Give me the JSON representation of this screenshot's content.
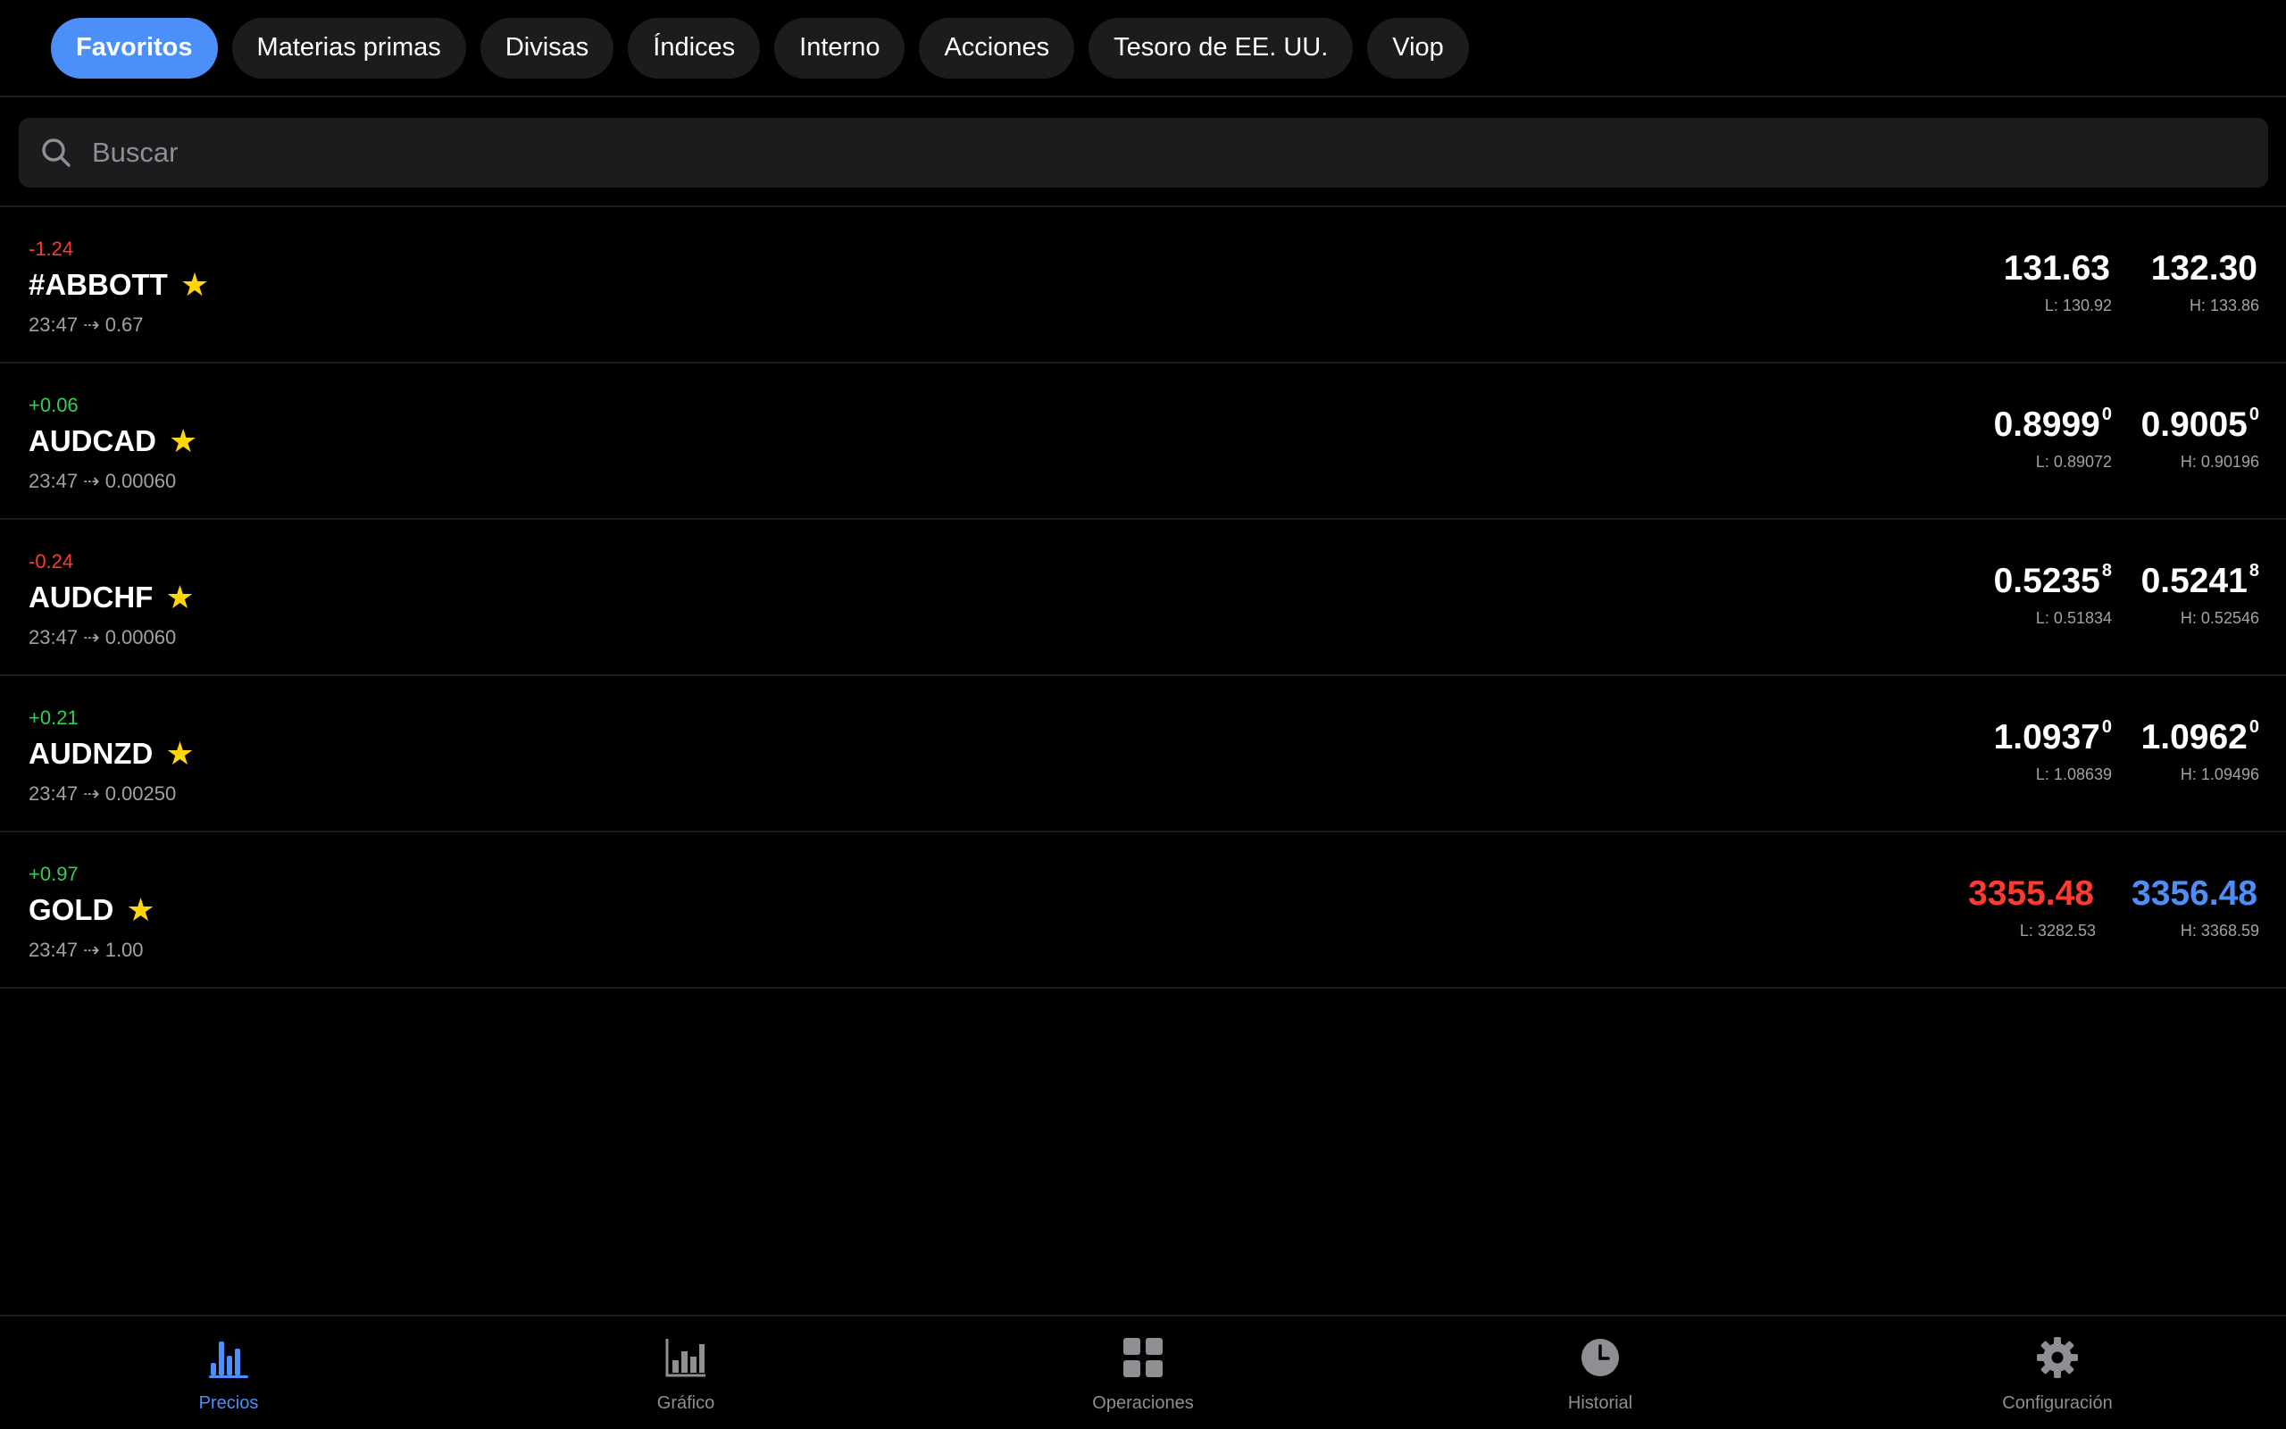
{
  "tabs": [
    {
      "label": "Favoritos",
      "active": true
    },
    {
      "label": "Materias primas"
    },
    {
      "label": "Divisas"
    },
    {
      "label": "Índices"
    },
    {
      "label": "Interno"
    },
    {
      "label": "Acciones"
    },
    {
      "label": "Tesoro de EE. UU."
    },
    {
      "label": "Viop"
    }
  ],
  "search": {
    "placeholder": "Buscar"
  },
  "instruments": [
    {
      "change": "-1.24",
      "symbol": "#ABBOTT",
      "meta": "23:47 ⇢ 0.67",
      "bid": "131.63",
      "bid_sup": "",
      "low": "L: 130.92",
      "ask": "132.30",
      "ask_sup": "",
      "high": "H: 133.86"
    },
    {
      "change": "+0.06",
      "symbol": "AUDCAD",
      "meta": "23:47 ⇢ 0.00060",
      "bid": "0.8999",
      "bid_sup": "0",
      "low": "L: 0.89072",
      "ask": "0.9005",
      "ask_sup": "0",
      "high": "H: 0.90196"
    },
    {
      "change": "-0.24",
      "symbol": "AUDCHF",
      "meta": "23:47 ⇢ 0.00060",
      "bid": "0.5235",
      "bid_sup": "8",
      "low": "L: 0.51834",
      "ask": "0.5241",
      "ask_sup": "8",
      "high": "H: 0.52546"
    },
    {
      "change": "+0.21",
      "symbol": "AUDNZD",
      "meta": "23:47 ⇢ 0.00250",
      "bid": "1.0937",
      "bid_sup": "0",
      "low": "L: 1.08639",
      "ask": "1.0962",
      "ask_sup": "0",
      "high": "H: 1.09496"
    },
    {
      "change": "+0.97",
      "symbol": "GOLD",
      "meta": "23:47 ⇢ 1.00",
      "bid": "3355.48",
      "bid_sup": "",
      "low": "L: 3282.53",
      "ask": "3356.48",
      "ask_sup": "",
      "high": "H: 3368.59"
    }
  ],
  "bottom_nav": [
    {
      "label": "Precios",
      "icon": "bar-chart-icon",
      "active": true
    },
    {
      "label": "Gráfico",
      "icon": "chart-icon"
    },
    {
      "label": "Operaciones",
      "icon": "grid-icon"
    },
    {
      "label": "Historial",
      "icon": "clock-icon"
    },
    {
      "label": "Configuración",
      "icon": "gear-icon"
    }
  ],
  "colors": {
    "accent": "#4d8ff8",
    "positive": "#30d158",
    "negative": "#ff3b30",
    "star": "#ffd60a",
    "surface": "#1c1c1e"
  }
}
